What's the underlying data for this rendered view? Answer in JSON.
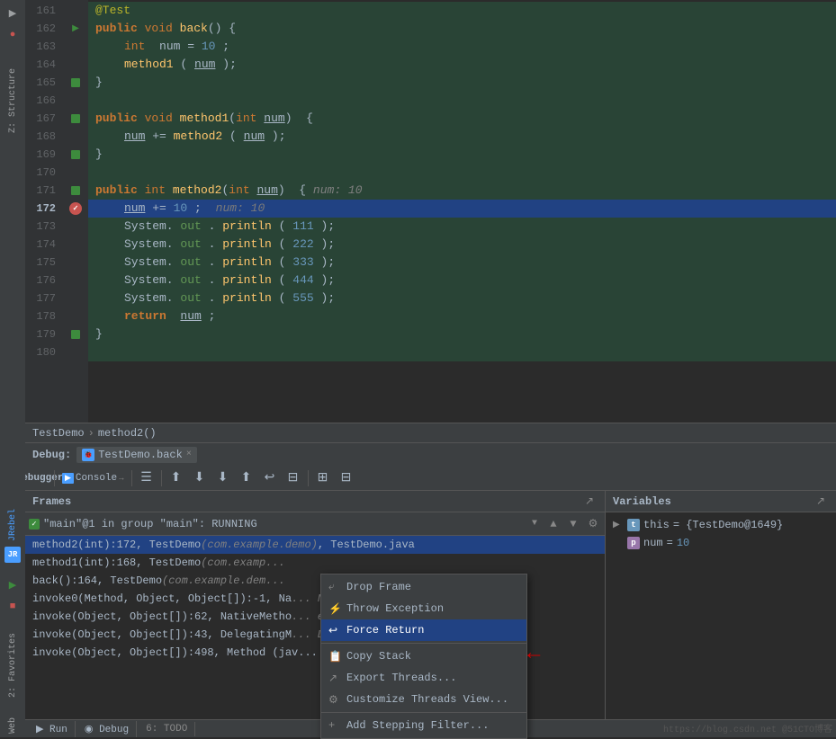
{
  "editor": {
    "lines": [
      {
        "num": "161",
        "indent": 0,
        "content": "@Test",
        "type": "annotation",
        "gutter": ""
      },
      {
        "num": "162",
        "indent": 0,
        "content": "public void back() {",
        "type": "code",
        "gutter": "run"
      },
      {
        "num": "163",
        "indent": 1,
        "content": "int num = 10;",
        "type": "code",
        "gutter": ""
      },
      {
        "num": "164",
        "indent": 1,
        "content": "method1(num);",
        "type": "code",
        "gutter": ""
      },
      {
        "num": "165",
        "indent": 0,
        "content": "}",
        "type": "code",
        "gutter": "dot"
      },
      {
        "num": "166",
        "indent": 0,
        "content": "",
        "type": "empty",
        "gutter": ""
      },
      {
        "num": "167",
        "indent": 0,
        "content": "public void method1(int num)  {",
        "type": "code",
        "gutter": "dot"
      },
      {
        "num": "168",
        "indent": 1,
        "content": "num += method2(num);",
        "type": "code",
        "gutter": ""
      },
      {
        "num": "169",
        "indent": 0,
        "content": "}",
        "type": "code",
        "gutter": "dot"
      },
      {
        "num": "170",
        "indent": 0,
        "content": "",
        "type": "empty",
        "gutter": ""
      },
      {
        "num": "171",
        "indent": 0,
        "content": "public int method2(int num)  {  num: 10",
        "type": "code",
        "gutter": "dot"
      },
      {
        "num": "172",
        "indent": 1,
        "content": "num += 10;  num: 10",
        "type": "highlighted",
        "gutter": "breakpoint"
      },
      {
        "num": "173",
        "indent": 1,
        "content": "System.out.println(111);",
        "type": "code",
        "gutter": ""
      },
      {
        "num": "174",
        "indent": 1,
        "content": "System.out.println(222);",
        "type": "code",
        "gutter": ""
      },
      {
        "num": "175",
        "indent": 1,
        "content": "System.out.println(333);",
        "type": "code",
        "gutter": ""
      },
      {
        "num": "176",
        "indent": 1,
        "content": "System.out.println(444);",
        "type": "code",
        "gutter": ""
      },
      {
        "num": "177",
        "indent": 1,
        "content": "System.out.println(555);",
        "type": "code",
        "gutter": ""
      },
      {
        "num": "178",
        "indent": 1,
        "content": "return num;",
        "type": "code",
        "gutter": ""
      },
      {
        "num": "179",
        "indent": 0,
        "content": "}",
        "type": "code",
        "gutter": "dot"
      },
      {
        "num": "180",
        "indent": 0,
        "content": "",
        "type": "empty",
        "gutter": ""
      }
    ]
  },
  "breadcrumb": {
    "items": [
      "TestDemo",
      "method2()"
    ],
    "separator": "›"
  },
  "debug": {
    "label": "Debug:",
    "tab_icon": "🐞",
    "tab_name": "TestDemo.back",
    "close_label": "×"
  },
  "toolbar": {
    "buttons": [
      "↺",
      "⬆",
      "⬇",
      "⬇",
      "⬆",
      "↩",
      "⊟",
      "⊞"
    ]
  },
  "frames_panel": {
    "title": "Frames",
    "thread_name": "\"main\"@1 in group \"main\": RUNNING",
    "frames": [
      {
        "name": "method2(int):172, TestDemo (com.example.demo), TestDemo.java",
        "selected": true
      },
      {
        "name": "method1(int):168, TestDemo (com.examp..."
      },
      {
        "name": "back():164, TestDemo (com.example.dem..."
      },
      {
        "name": "invoke0(Method, Object, Object[]):-1, Na..."
      },
      {
        "name": "invoke(Object, Object[]):62, NativeMetho..."
      },
      {
        "name": "invoke(Object, Object[]):43, DelegatingM..."
      },
      {
        "name": "invoke(Object, Object[]):498, Method (jav..."
      }
    ]
  },
  "variables_panel": {
    "title": "Variables",
    "items": [
      {
        "name": "this",
        "value": "= {TestDemo@1649}",
        "icon": "t",
        "indent": 0,
        "has_arrow": true
      },
      {
        "name": "num",
        "value": "= 10",
        "icon": "p",
        "indent": 1,
        "has_arrow": false
      }
    ]
  },
  "context_menu": {
    "items": [
      {
        "label": "Drop Frame",
        "icon": "⤶",
        "active": false
      },
      {
        "label": "Throw Exception",
        "icon": "⚡",
        "active": false
      },
      {
        "label": "Force Return",
        "icon": "↩",
        "active": true
      },
      {
        "label": "Copy Stack",
        "icon": "📋",
        "active": false
      },
      {
        "label": "Export Threads...",
        "icon": "↗",
        "active": false
      },
      {
        "label": "Customize Threads View...",
        "icon": "⚙",
        "active": false
      },
      {
        "separator": true
      },
      {
        "label": "Add Stepping Filter...",
        "icon": "+",
        "active": false
      }
    ]
  },
  "bottom_tabs": {
    "tabs": [
      "▶ Run",
      "◉ Debug",
      "6: TODO"
    ]
  },
  "watermark": "https://blog.csdn.net @51CTO博客"
}
